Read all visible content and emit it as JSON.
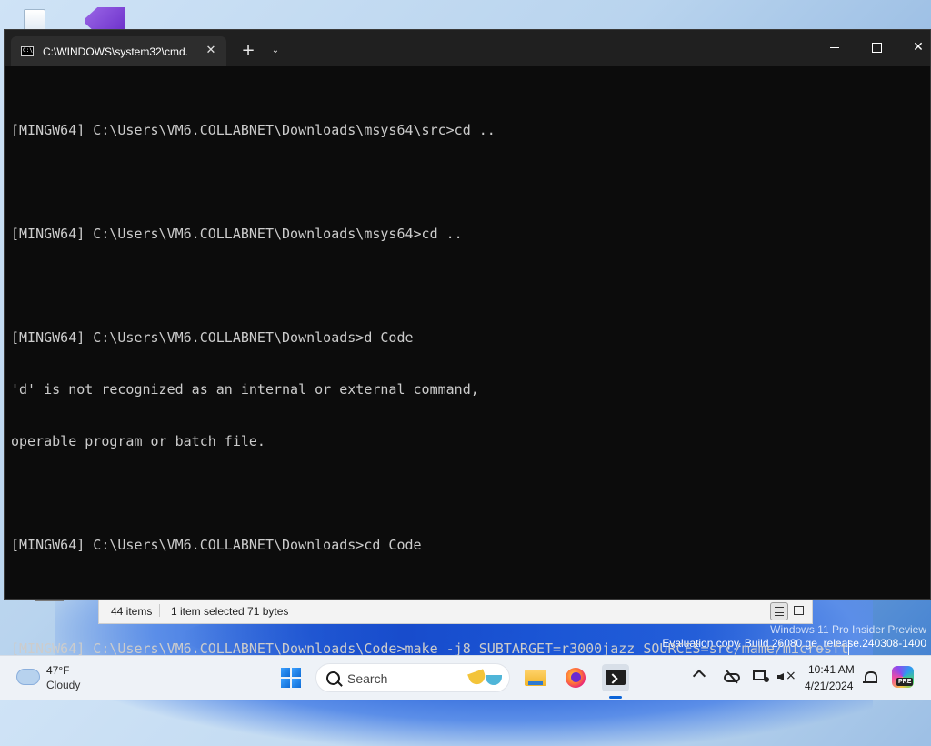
{
  "terminal": {
    "tab_title": "C:\\WINDOWS\\system32\\cmd.",
    "tab_close": "✕",
    "new_tab": "+",
    "dropdown": "⌄",
    "close": "✕",
    "lines": [
      "",
      "[MINGW64] C:\\Users\\VM6.COLLABNET\\Downloads\\msys64\\src>cd ..",
      "",
      "[MINGW64] C:\\Users\\VM6.COLLABNET\\Downloads\\msys64>cd ..",
      "",
      "[MINGW64] C:\\Users\\VM6.COLLABNET\\Downloads>d Code",
      "'d' is not recognized as an internal or external command,",
      "operable program or batch file.",
      "",
      "[MINGW64] C:\\Users\\VM6.COLLABNET\\Downloads>cd Code",
      "",
      "[MINGW64] C:\\Users\\VM6.COLLABNET\\Downloads\\Code>make -j8 SUBTARGET=r3000jazz SOURCES=src/mame/microsft"
    ]
  },
  "explorer_status": {
    "items": "44 items",
    "selected": "1 item selected  71 bytes"
  },
  "watermark": {
    "line1": "Windows 11 Pro Insider Preview",
    "line2": "Evaluation copy. Build 26080.ge_release.240308-1400"
  },
  "taskbar": {
    "weather_temp": "47°F",
    "weather_condition": "Cloudy",
    "search_placeholder": "Search",
    "time": "10:41 AM",
    "date": "4/21/2024",
    "copilot_badge": "PRE"
  }
}
